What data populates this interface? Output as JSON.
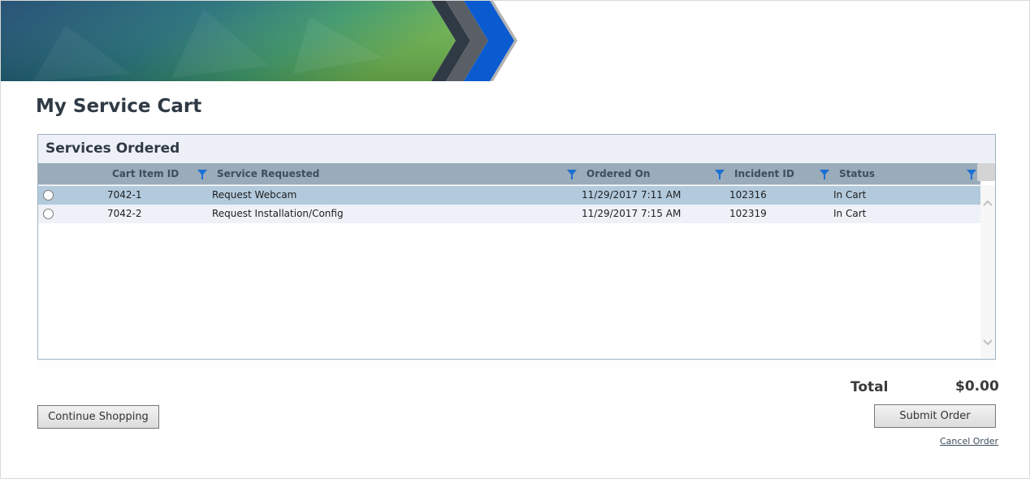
{
  "page": {
    "title": "My Service Cart"
  },
  "panel": {
    "title": "Services Ordered",
    "columns": [
      {
        "label": "Cart Item ID",
        "filter_icon": "filter-icon"
      },
      {
        "label": "Service Requested",
        "filter_icon": "filter-icon"
      },
      {
        "label": "Ordered On",
        "filter_icon": "filter-icon"
      },
      {
        "label": "Incident ID",
        "filter_icon": "filter-icon"
      },
      {
        "label": "Status",
        "filter_icon": "filter-icon"
      }
    ],
    "rows": [
      {
        "cart_item_id": "7042-1",
        "service": "Request Webcam",
        "ordered_on": "11/29/2017 7:11 AM",
        "incident_id": "102316",
        "status": "In Cart",
        "selected": false
      },
      {
        "cart_item_id": "7042-2",
        "service": "Request Installation/Config",
        "ordered_on": "11/29/2017 7:15 AM",
        "incident_id": "102319",
        "status": "In Cart",
        "selected": false
      }
    ]
  },
  "totals": {
    "label": "Total",
    "value": "$0.00"
  },
  "actions": {
    "continue_label": "Continue Shopping",
    "submit_label": "Submit Order",
    "cancel_label": "Cancel Order"
  },
  "colors": {
    "filter_icon": "#1a6fd4",
    "header_bg": "#9aabba",
    "selected_row": "#b3cadd",
    "alt_row": "#eef1f8",
    "accent_blue": "#0a5bd0"
  },
  "icons": {
    "scroll_up": "chevron-up-icon",
    "scroll_down": "chevron-down-icon",
    "banner": "banner-chevron-graphic"
  }
}
